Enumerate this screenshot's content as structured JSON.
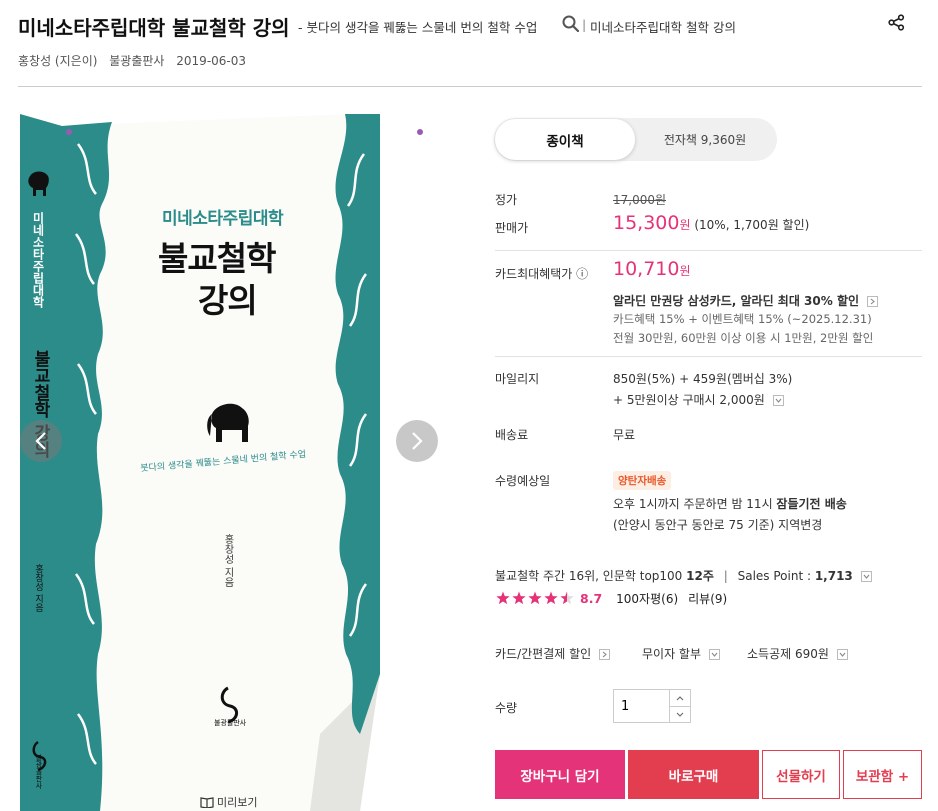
{
  "header": {
    "title": "미네소타주립대학 불교철학 강의",
    "subtitle": "- 붓다의 생각을 꿰뚫는 스물네 번의 철학 수업",
    "separator": "|",
    "original_title": "미네소타주립대학 철학 강의"
  },
  "meta": {
    "author": "홍창성 (지은이)",
    "publisher": "불광출판사",
    "date": "2019-06-03"
  },
  "cover": {
    "top_title": "미네소타주립대학",
    "main_title_1": "불교철학",
    "main_title_2": "강의",
    "tagline": "붓다의 생각을 꿰뚫는 스물네 번의 철학 수업",
    "author_credit": "홍창성 지음",
    "publisher_logo_text": "불광출판사",
    "spine_title": "미네소타주립대학",
    "spine_title_2": "불교철학 강의",
    "spine_author": "홍창성 지음",
    "spine_publisher": "불광출판사",
    "preview_label": "미리보기",
    "teal": "#2b8c8a"
  },
  "tabs": {
    "paper": "종이책",
    "ebook": "전자책 9,360원"
  },
  "price": {
    "list_label": "정가",
    "list_value": "17,000원",
    "sale_label": "판매가",
    "sale_value": "15,300",
    "sale_unit": "원",
    "sale_note": "(10%, 1,700원 할인)"
  },
  "card": {
    "label": "카드최대혜택가",
    "info_icon": "ⓘ",
    "value": "10,710",
    "unit": "원",
    "headline": "알라딘 만권당 삼성카드, 알라딘 최대 30% 할인",
    "detail_1": "카드혜택 15% + 이벤트혜택 15% (~2025.12.31)",
    "detail_2": "전월 30만원, 60만원 이상 이용 시 1만원, 2만원 할인"
  },
  "mileage": {
    "label": "마일리지",
    "line_1": "850원(5%) + 459원(멤버십 3%)",
    "line_2": "+ 5만원이상 구매시 2,000원"
  },
  "shipping": {
    "label": "배송료",
    "value": "무료"
  },
  "delivery": {
    "label": "수령예상일",
    "badge": "양탄자배송",
    "line_1_pre": "오후 1시까지 주문하면 밤 11시 ",
    "line_1_bold": "잠들기전 배송",
    "line_2_pre": "(안양시 동안구 동안로 75 기준) ",
    "line_2_link": "지역변경"
  },
  "rank": {
    "text_pre": "불교철학 주간 16위, 인문학 top100 ",
    "text_bold": "12주",
    "sep": "|",
    "sales_pre": "Sales Point : ",
    "sales_val": "1,713"
  },
  "rating": {
    "score": "8.7",
    "reviews_100": "100자평(6)",
    "reviews": "리뷰(9)",
    "stars_filled": 4.5,
    "star_color": "#e5337a"
  },
  "options": {
    "card_discount": "카드/간편결제 할인",
    "installment": "무이자 할부",
    "tax": "소득공제 690원"
  },
  "quantity": {
    "label": "수량",
    "value": "1"
  },
  "buttons": {
    "cart": "장바구니 담기",
    "buy": "바로구매",
    "gift": "선물하기",
    "keep": "보관함 +"
  }
}
